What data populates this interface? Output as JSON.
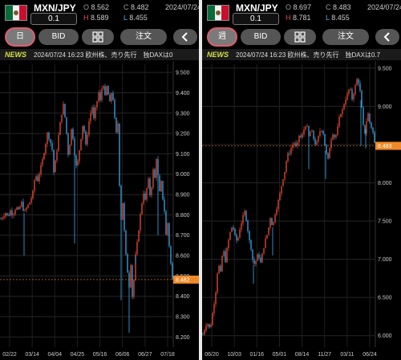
{
  "colors": {
    "up": "#e0482f",
    "down": "#3a9bd8",
    "price_tag": "#f08a28",
    "period_ring": "#e65a6e",
    "news_label": "#d8e048"
  },
  "left": {
    "pair": "MXN/JPY",
    "lot": "0.1",
    "open_label": "O",
    "open": "8.562",
    "close_label": "C",
    "close": "8.482",
    "high_label": "H",
    "high": "8.589",
    "low_label": "L",
    "low": "8.455",
    "date": "2024/07/24",
    "toolbar": {
      "period": "日",
      "bid": "BID",
      "grid_icon": "grid-icon",
      "order": "注文",
      "back_icon": "chevron-left-icon"
    },
    "news": {
      "label": "NEWS",
      "text": "2024/07/24 16:23 欧州株、売り先行　独DAXは0"
    },
    "chart_data": {
      "type": "candlestick",
      "y_ticks": [
        "9.500",
        "9.400",
        "9.300",
        "9.200",
        "9.100",
        "9.000",
        "8.900",
        "8.800",
        "8.700",
        "8.600",
        "8.500",
        "8.400",
        "8.300",
        "8.200"
      ],
      "ylim": [
        8.15,
        9.54
      ],
      "x_ticks": [
        "02/22",
        "03/14",
        "04/04",
        "04/25",
        "05/16",
        "06/06",
        "06/27",
        "07/18"
      ],
      "last_price": "8.482",
      "close_path": [
        [
          0,
          8.78
        ],
        [
          6,
          8.81
        ],
        [
          9,
          8.79
        ],
        [
          12,
          8.82
        ],
        [
          15,
          8.8
        ],
        [
          19,
          8.84
        ],
        [
          22,
          8.82
        ],
        [
          26,
          8.86
        ],
        [
          29,
          8.81
        ],
        [
          33,
          8.84
        ],
        [
          37,
          8.87
        ],
        [
          40,
          8.91
        ],
        [
          43,
          9.0
        ],
        [
          46,
          8.97
        ],
        [
          49,
          9.02
        ],
        [
          52,
          9.07
        ],
        [
          55,
          9.13
        ],
        [
          58,
          9.2
        ],
        [
          61,
          9.17
        ],
        [
          64,
          9.12
        ],
        [
          66,
          9.01
        ],
        [
          68,
          9.06
        ],
        [
          70,
          9.12
        ],
        [
          72,
          9.19
        ],
        [
          74,
          9.25
        ],
        [
          76,
          9.3
        ],
        [
          78,
          9.34
        ],
        [
          80,
          9.28
        ],
        [
          82,
          9.2
        ],
        [
          84,
          9.1
        ],
        [
          86,
          9.15
        ],
        [
          88,
          9.22
        ],
        [
          90,
          9.18
        ],
        [
          92,
          9.1
        ],
        [
          94,
          9.04
        ],
        [
          96,
          9.06
        ],
        [
          98,
          9.12
        ],
        [
          100,
          9.18
        ],
        [
          102,
          9.24
        ],
        [
          104,
          9.21
        ],
        [
          106,
          9.14
        ],
        [
          108,
          9.2
        ],
        [
          110,
          9.26
        ],
        [
          112,
          9.3
        ],
        [
          114,
          9.33
        ],
        [
          116,
          9.27
        ],
        [
          118,
          9.32
        ],
        [
          120,
          9.36
        ],
        [
          122,
          9.4
        ],
        [
          124,
          9.36
        ],
        [
          126,
          9.42
        ],
        [
          128,
          9.44
        ],
        [
          130,
          9.38
        ],
        [
          132,
          9.43
        ],
        [
          134,
          9.39
        ],
        [
          136,
          9.35
        ],
        [
          138,
          9.4
        ],
        [
          140,
          9.37
        ],
        [
          142,
          9.27
        ],
        [
          144,
          9.2
        ],
        [
          146,
          9.25
        ],
        [
          148,
          8.95
        ],
        [
          150,
          8.78
        ],
        [
          152,
          8.86
        ],
        [
          154,
          8.72
        ],
        [
          156,
          8.6
        ],
        [
          158,
          8.52
        ],
        [
          160,
          8.45
        ],
        [
          162,
          8.56
        ],
        [
          164,
          8.4
        ],
        [
          166,
          8.48
        ],
        [
          168,
          8.6
        ],
        [
          170,
          8.66
        ],
        [
          172,
          8.73
        ],
        [
          174,
          8.8
        ],
        [
          176,
          8.86
        ],
        [
          178,
          8.91
        ],
        [
          180,
          8.87
        ],
        [
          182,
          8.93
        ],
        [
          184,
          8.97
        ],
        [
          186,
          8.9
        ],
        [
          188,
          8.94
        ],
        [
          190,
          9.02
        ],
        [
          192,
          8.98
        ],
        [
          194,
          9.08
        ],
        [
          196,
          8.99
        ],
        [
          198,
          8.91
        ],
        [
          200,
          8.96
        ],
        [
          202,
          8.88
        ],
        [
          204,
          8.82
        ],
        [
          206,
          8.7
        ],
        [
          208,
          8.76
        ],
        [
          210,
          8.65
        ],
        [
          212,
          8.56
        ],
        [
          214,
          8.48
        ]
      ],
      "spikes": [
        [
          29,
          8.6
        ],
        [
          92,
          8.66
        ],
        [
          150,
          8.38
        ],
        [
          160,
          8.22
        ],
        [
          168,
          8.56
        ],
        [
          196,
          8.7
        ]
      ]
    }
  },
  "right": {
    "pair": "MXN/JPY",
    "lot": "0.1",
    "open_label": "O",
    "open": "8.697",
    "close_label": "C",
    "close": "8.483",
    "high_label": "H",
    "high": "8.781",
    "low_label": "L",
    "low": "8.455",
    "date": "2024/07/24",
    "toolbar": {
      "period": "週",
      "bid": "BID",
      "grid_icon": "grid-icon",
      "order": "注文",
      "back_icon": "chevron-left-icon"
    },
    "news": {
      "label": "NEWS",
      "text": "2024/07/24 16:23 欧州株、売り先行　独DAXは0.7"
    },
    "chart_data": {
      "type": "candlestick",
      "y_ticks": [
        "9.500",
        "9.000",
        "8.500",
        "8.000",
        "7.500",
        "7.000",
        "6.500",
        "6.000"
      ],
      "ylim": [
        5.85,
        9.55
      ],
      "x_ticks": [
        "06/20",
        "10/03",
        "01/16",
        "05/01",
        "08/14",
        "11/27",
        "03/11",
        "06/24"
      ],
      "last_price": "8.483",
      "close_path": [
        [
          0,
          6.02
        ],
        [
          5,
          6.18
        ],
        [
          9,
          6.08
        ],
        [
          13,
          6.36
        ],
        [
          16,
          6.58
        ],
        [
          19,
          6.95
        ],
        [
          22,
          6.82
        ],
        [
          25,
          7.15
        ],
        [
          28,
          6.98
        ],
        [
          31,
          7.2
        ],
        [
          34,
          7.35
        ],
        [
          37,
          7.45
        ],
        [
          40,
          7.3
        ],
        [
          43,
          7.22
        ],
        [
          46,
          7.4
        ],
        [
          49,
          7.52
        ],
        [
          52,
          7.62
        ],
        [
          55,
          7.48
        ],
        [
          57,
          7.28
        ],
        [
          60,
          7.15
        ],
        [
          63,
          6.92
        ],
        [
          66,
          6.98
        ],
        [
          69,
          7.08
        ],
        [
          72,
          6.95
        ],
        [
          75,
          7.12
        ],
        [
          78,
          7.26
        ],
        [
          81,
          7.35
        ],
        [
          84,
          7.55
        ],
        [
          87,
          7.42
        ],
        [
          90,
          7.6
        ],
        [
          93,
          7.72
        ],
        [
          96,
          7.85
        ],
        [
          99,
          8.02
        ],
        [
          102,
          8.15
        ],
        [
          105,
          8.35
        ],
        [
          108,
          8.4
        ],
        [
          111,
          8.48
        ],
        [
          114,
          8.52
        ],
        [
          117,
          8.45
        ],
        [
          120,
          8.62
        ],
        [
          123,
          8.58
        ],
        [
          126,
          8.7
        ],
        [
          129,
          8.78
        ],
        [
          132,
          8.6
        ],
        [
          135,
          8.7
        ],
        [
          138,
          8.58
        ],
        [
          141,
          8.48
        ],
        [
          144,
          8.6
        ],
        [
          147,
          8.72
        ],
        [
          150,
          8.65
        ],
        [
          153,
          8.42
        ],
        [
          156,
          8.3
        ],
        [
          159,
          8.55
        ],
        [
          162,
          8.65
        ],
        [
          165,
          8.58
        ],
        [
          168,
          8.72
        ],
        [
          171,
          8.9
        ],
        [
          174,
          8.95
        ],
        [
          177,
          9.08
        ],
        [
          180,
          9.15
        ],
        [
          183,
          9.25
        ],
        [
          186,
          9.1
        ],
        [
          189,
          9.22
        ],
        [
          192,
          9.35
        ],
        [
          195,
          9.3
        ],
        [
          197,
          9.08
        ],
        [
          199,
          8.86
        ],
        [
          201,
          8.62
        ],
        [
          203,
          8.7
        ],
        [
          205,
          8.92
        ],
        [
          207,
          8.88
        ],
        [
          209,
          8.7
        ],
        [
          211,
          8.76
        ],
        [
          213,
          8.55
        ],
        [
          215,
          8.48
        ]
      ],
      "spikes": [
        [
          63,
          6.68
        ],
        [
          87,
          7.05
        ],
        [
          132,
          8.18
        ],
        [
          153,
          8.05
        ],
        [
          197,
          8.48
        ],
        [
          203,
          8.45
        ]
      ]
    }
  }
}
